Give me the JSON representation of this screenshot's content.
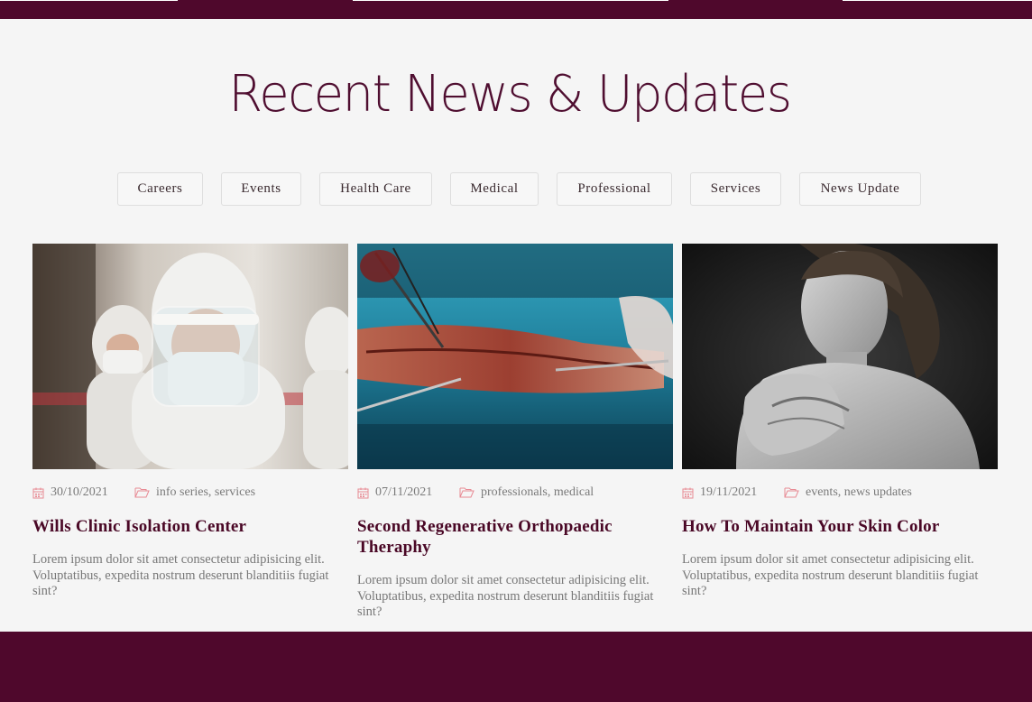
{
  "colors": {
    "brand": "#4f082c",
    "title": "#4f0e30",
    "meta_icon": "#e88a94",
    "text_muted": "#777777"
  },
  "section": {
    "title": "Recent News & Updates"
  },
  "filters": [
    {
      "label": "Careers"
    },
    {
      "label": "Events"
    },
    {
      "label": "Health Care"
    },
    {
      "label": "Medical"
    },
    {
      "label": "Professional"
    },
    {
      "label": "Services"
    },
    {
      "label": "News Update"
    }
  ],
  "posts": [
    {
      "date": "30/10/2021",
      "categories": "info series, services",
      "title": "Wills Clinic Isolation Center",
      "excerpt": "Lorem ipsum dolor sit amet consectetur adipisicing elit. Voluptatibus, expedita nostrum deserunt blanditiis fugiat sint?",
      "image_icon": "healthcare-workers-ppe-photo"
    },
    {
      "date": "07/11/2021",
      "categories": "professionals, medical",
      "title": "Second Regenerative Orthopaedic Theraphy",
      "excerpt": "Lorem ipsum dolor sit amet consectetur adipisicing elit. Voluptatibus, expedita nostrum deserunt blanditiis fugiat sint?",
      "image_icon": "surgery-arm-photo"
    },
    {
      "date": "19/11/2021",
      "categories": "events, news updates",
      "title": "How To Maintain Your Skin Color",
      "excerpt": "Lorem ipsum dolor sit amet consectetur adipisicing elit. Voluptatibus, expedita nostrum deserunt blanditiis fugiat sint?",
      "image_icon": "woman-portrait-bw-photo"
    }
  ]
}
